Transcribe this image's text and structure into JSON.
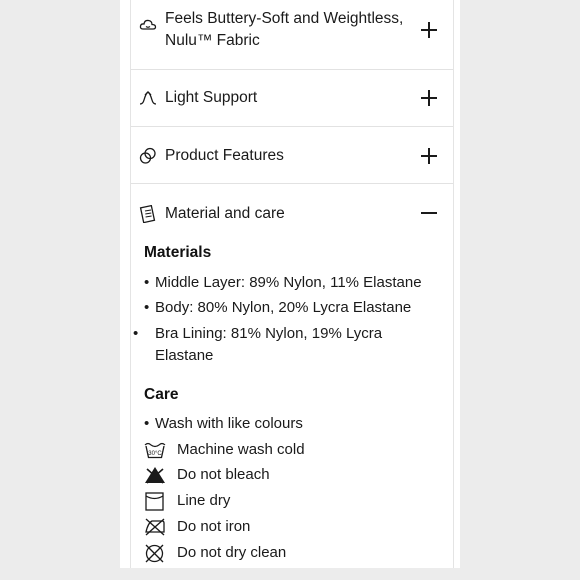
{
  "accordion": [
    {
      "label": "Feels Buttery-Soft and Weightless, Nulu™ Fabric",
      "icon": "cloud-icon",
      "state": "+"
    },
    {
      "label": "Light Support",
      "icon": "support-arrow-icon",
      "state": "+"
    },
    {
      "label": "Product Features",
      "icon": "features-circles-icon",
      "state": "+"
    },
    {
      "label": "Material and care",
      "icon": "document-icon",
      "state": "−"
    }
  ],
  "materials": {
    "title": "Materials",
    "items": [
      "Middle Layer: 89% Nylon, 11% Elastane",
      "Body: 80% Nylon, 20% Lycra Elastane",
      "Bra Lining: 81% Nylon, 19% Lycra Elastane"
    ]
  },
  "care": {
    "title": "Care",
    "bullet": "Wash with like colours",
    "items": [
      {
        "label": "Machine wash cold",
        "icon": "wash-cold-icon",
        "temp": "30°C"
      },
      {
        "label": "Do not bleach",
        "icon": "no-bleach-icon"
      },
      {
        "label": "Line dry",
        "icon": "line-dry-icon"
      },
      {
        "label": "Do not iron",
        "icon": "no-iron-icon"
      },
      {
        "label": "Do not dry clean",
        "icon": "no-dry-clean-icon"
      }
    ]
  }
}
